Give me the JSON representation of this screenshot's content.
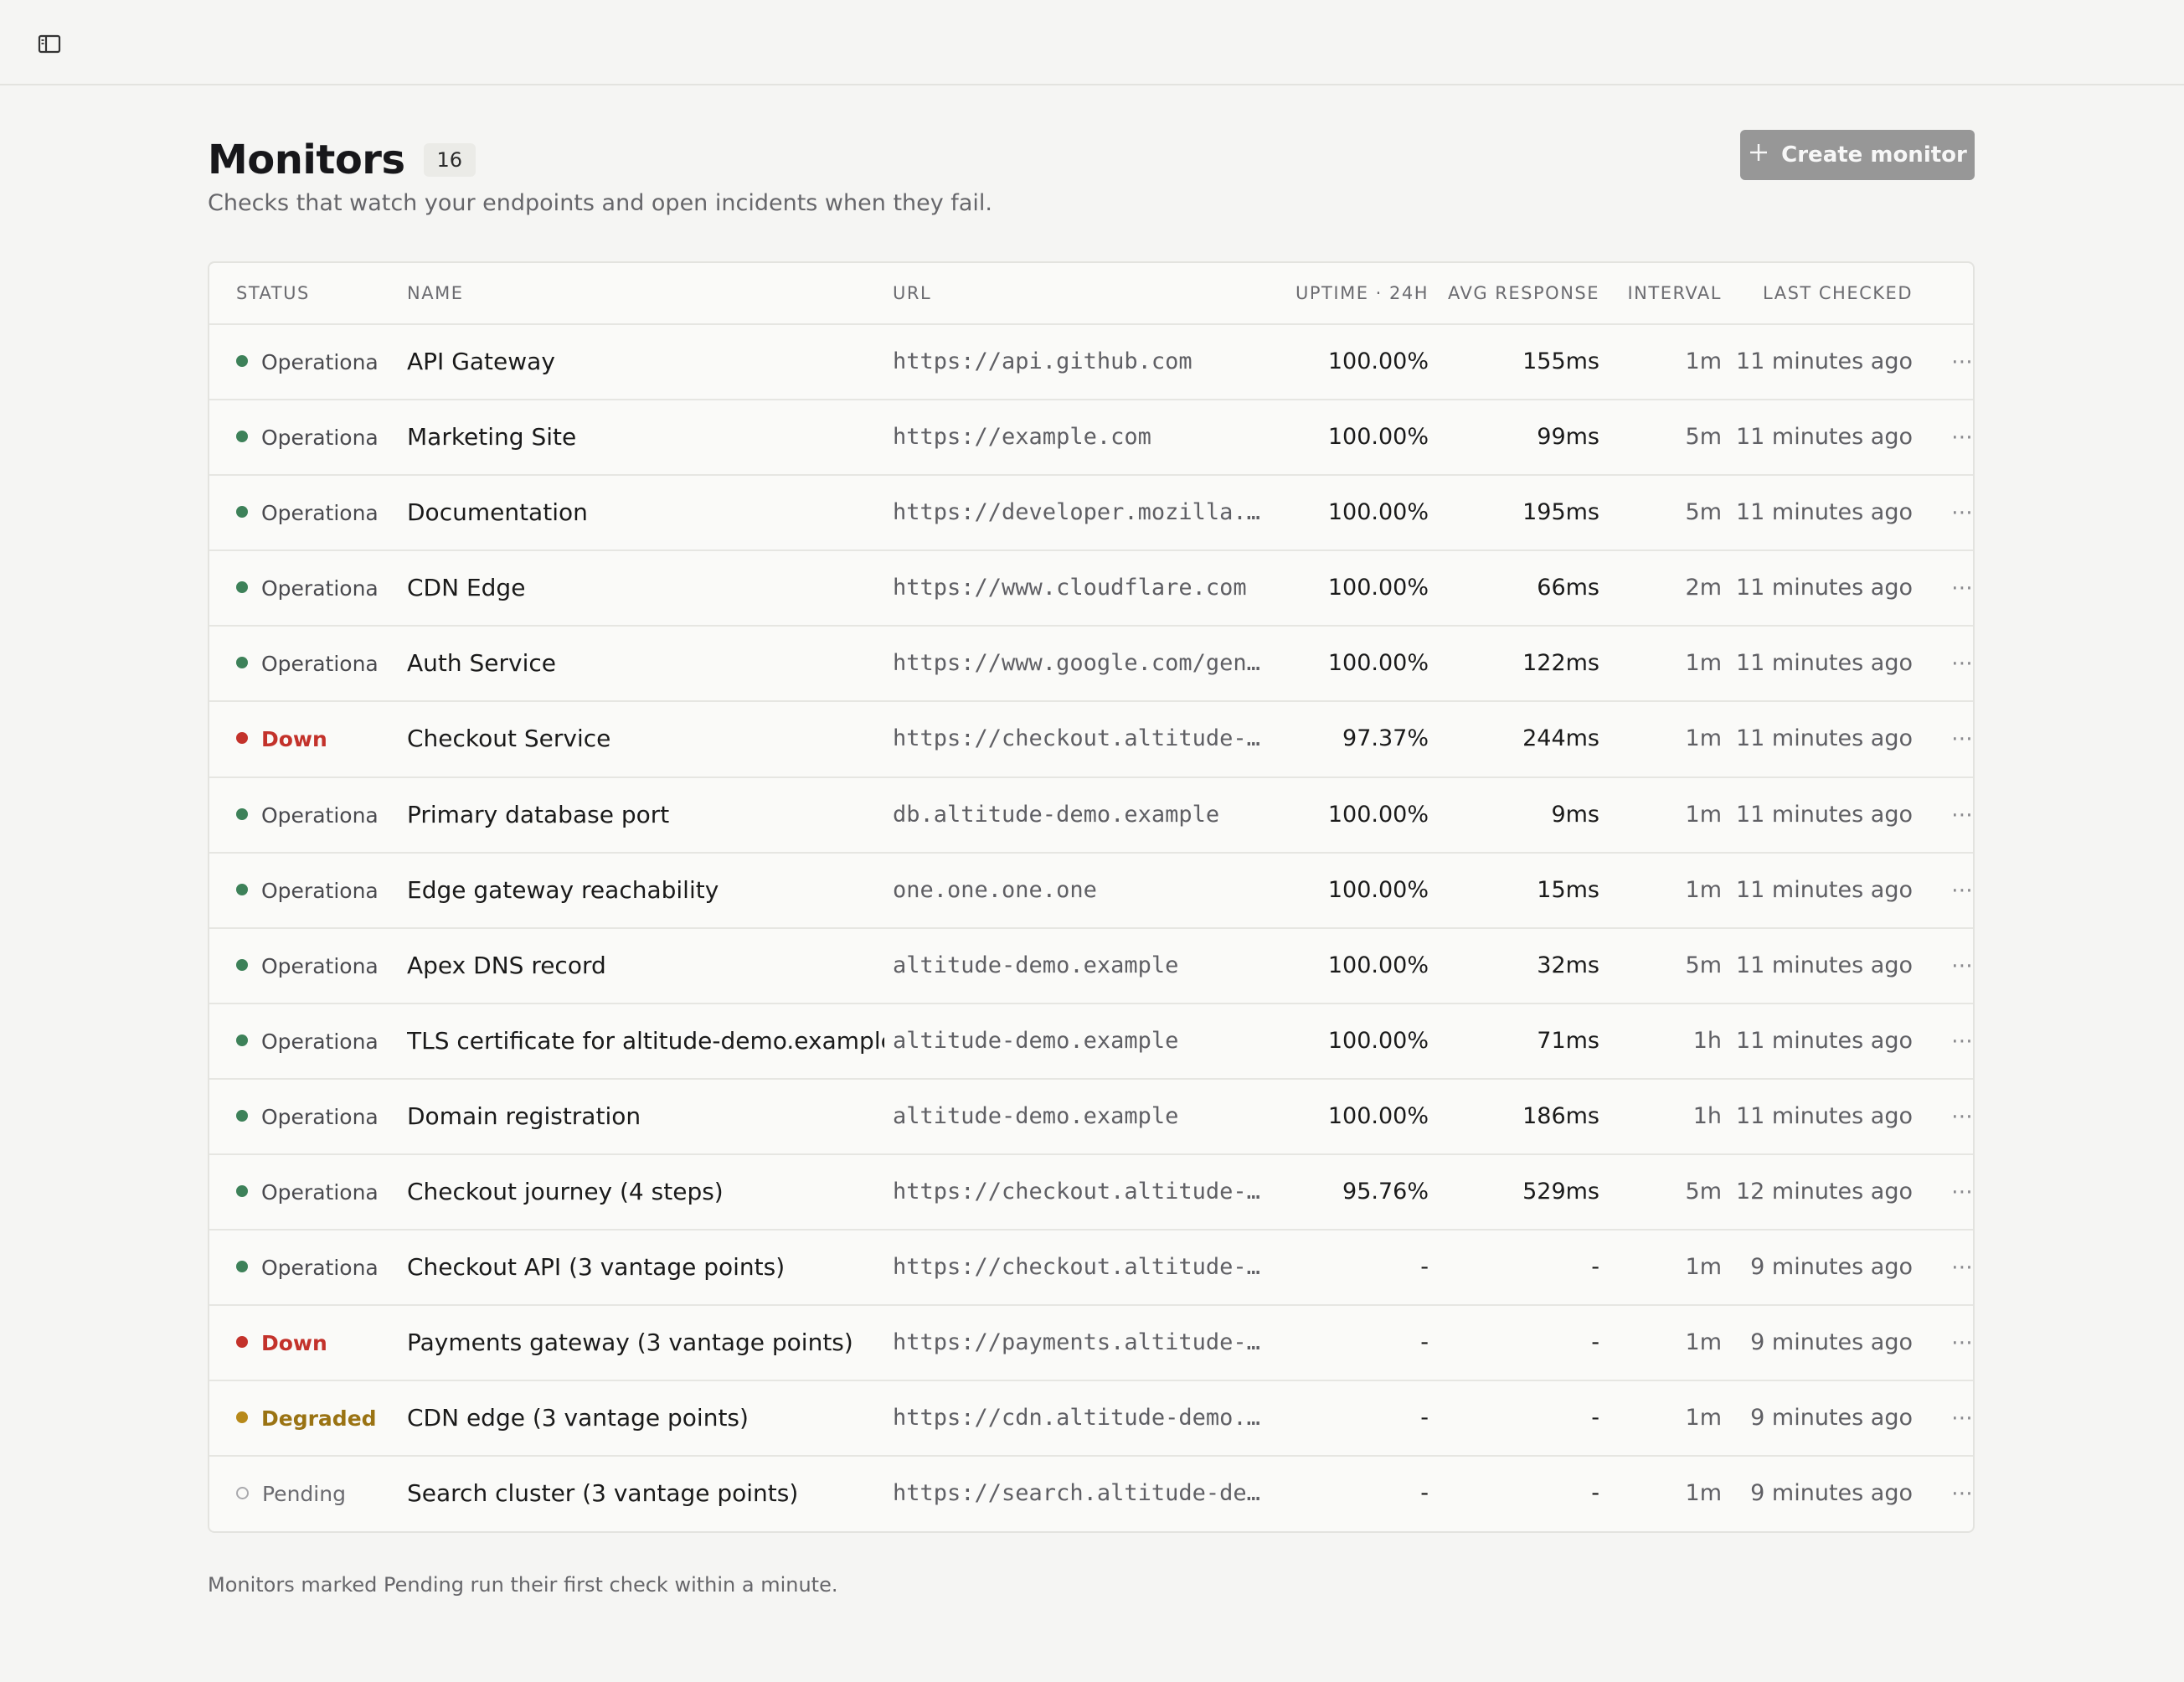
{
  "header": {
    "title": "Monitors",
    "count": "16",
    "subtitle": "Checks that watch your endpoints and open incidents when they fail.",
    "create_button": "Create monitor"
  },
  "columns": {
    "status": "STATUS",
    "name": "NAME",
    "url": "URL",
    "uptime": "UPTIME · 24H",
    "avg_response": "AVG RESPONSE",
    "interval": "INTERVAL",
    "last_checked": "LAST CHECKED"
  },
  "status_colors": {
    "Operational": "#3d8159",
    "Down": "#c3322b",
    "Degraded": "#b7891a",
    "Pending": "#a9a9ad"
  },
  "status_text_colors": {
    "Operational": "#4a4a4f",
    "Down": "#c3322b",
    "Degraded": "#9a7313",
    "Pending": "#6b6b70"
  },
  "monitors": [
    {
      "status": "Operational",
      "name": "API Gateway",
      "url": "https://api.github.com",
      "uptime": "100.00%",
      "avg_response": "155ms",
      "interval": "1m",
      "last_checked": "11 minutes ago"
    },
    {
      "status": "Operational",
      "name": "Marketing Site",
      "url": "https://example.com",
      "uptime": "100.00%",
      "avg_response": "99ms",
      "interval": "5m",
      "last_checked": "11 minutes ago"
    },
    {
      "status": "Operational",
      "name": "Documentation",
      "url": "https://developer.mozilla.o…",
      "uptime": "100.00%",
      "avg_response": "195ms",
      "interval": "5m",
      "last_checked": "11 minutes ago"
    },
    {
      "status": "Operational",
      "name": "CDN Edge",
      "url": "https://www.cloudflare.com",
      "uptime": "100.00%",
      "avg_response": "66ms",
      "interval": "2m",
      "last_checked": "11 minutes ago"
    },
    {
      "status": "Operational",
      "name": "Auth Service",
      "url": "https://www.google.com/gene…",
      "uptime": "100.00%",
      "avg_response": "122ms",
      "interval": "1m",
      "last_checked": "11 minutes ago"
    },
    {
      "status": "Down",
      "name": "Checkout Service",
      "url": "https://checkout.altitude-d…",
      "uptime": "97.37%",
      "avg_response": "244ms",
      "interval": "1m",
      "last_checked": "11 minutes ago"
    },
    {
      "status": "Operational",
      "name": "Primary database port",
      "url": "db.altitude-demo.example",
      "uptime": "100.00%",
      "avg_response": "9ms",
      "interval": "1m",
      "last_checked": "11 minutes ago"
    },
    {
      "status": "Operational",
      "name": "Edge gateway reachability",
      "url": "one.one.one.one",
      "uptime": "100.00%",
      "avg_response": "15ms",
      "interval": "1m",
      "last_checked": "11 minutes ago"
    },
    {
      "status": "Operational",
      "name": "Apex DNS record",
      "url": "altitude-demo.example",
      "uptime": "100.00%",
      "avg_response": "32ms",
      "interval": "5m",
      "last_checked": "11 minutes ago"
    },
    {
      "status": "Operational",
      "name": "TLS certificate for altitude-demo.example",
      "url": "altitude-demo.example",
      "uptime": "100.00%",
      "avg_response": "71ms",
      "interval": "1h",
      "last_checked": "11 minutes ago"
    },
    {
      "status": "Operational",
      "name": "Domain registration",
      "url": "altitude-demo.example",
      "uptime": "100.00%",
      "avg_response": "186ms",
      "interval": "1h",
      "last_checked": "11 minutes ago"
    },
    {
      "status": "Operational",
      "name": "Checkout journey (4 steps)",
      "url": "https://checkout.altitude-d…",
      "uptime": "95.76%",
      "avg_response": "529ms",
      "interval": "5m",
      "last_checked": "12 minutes ago"
    },
    {
      "status": "Operational",
      "name": "Checkout API (3 vantage points)",
      "url": "https://checkout.altitude-d…",
      "uptime": "-",
      "avg_response": "-",
      "interval": "1m",
      "last_checked": "9 minutes ago"
    },
    {
      "status": "Down",
      "name": "Payments gateway (3 vantage points)",
      "url": "https://payments.altitude-d…",
      "uptime": "-",
      "avg_response": "-",
      "interval": "1m",
      "last_checked": "9 minutes ago"
    },
    {
      "status": "Degraded",
      "name": "CDN edge (3 vantage points)",
      "url": "https://cdn.altitude-demo.e…",
      "uptime": "-",
      "avg_response": "-",
      "interval": "1m",
      "last_checked": "9 minutes ago"
    },
    {
      "status": "Pending",
      "name": "Search cluster (3 vantage points)",
      "url": "https://search.altitude-dem…",
      "uptime": "-",
      "avg_response": "-",
      "interval": "1m",
      "last_checked": "9 minutes ago"
    }
  ],
  "row_action_glyph": "⋯",
  "footer_note": "Monitors marked Pending run their first check within a minute.",
  "icons": {
    "sidebar_toggle": "sidebar-toggle-icon",
    "create": "plus-icon",
    "row_menu": "more-horizontal-icon"
  }
}
